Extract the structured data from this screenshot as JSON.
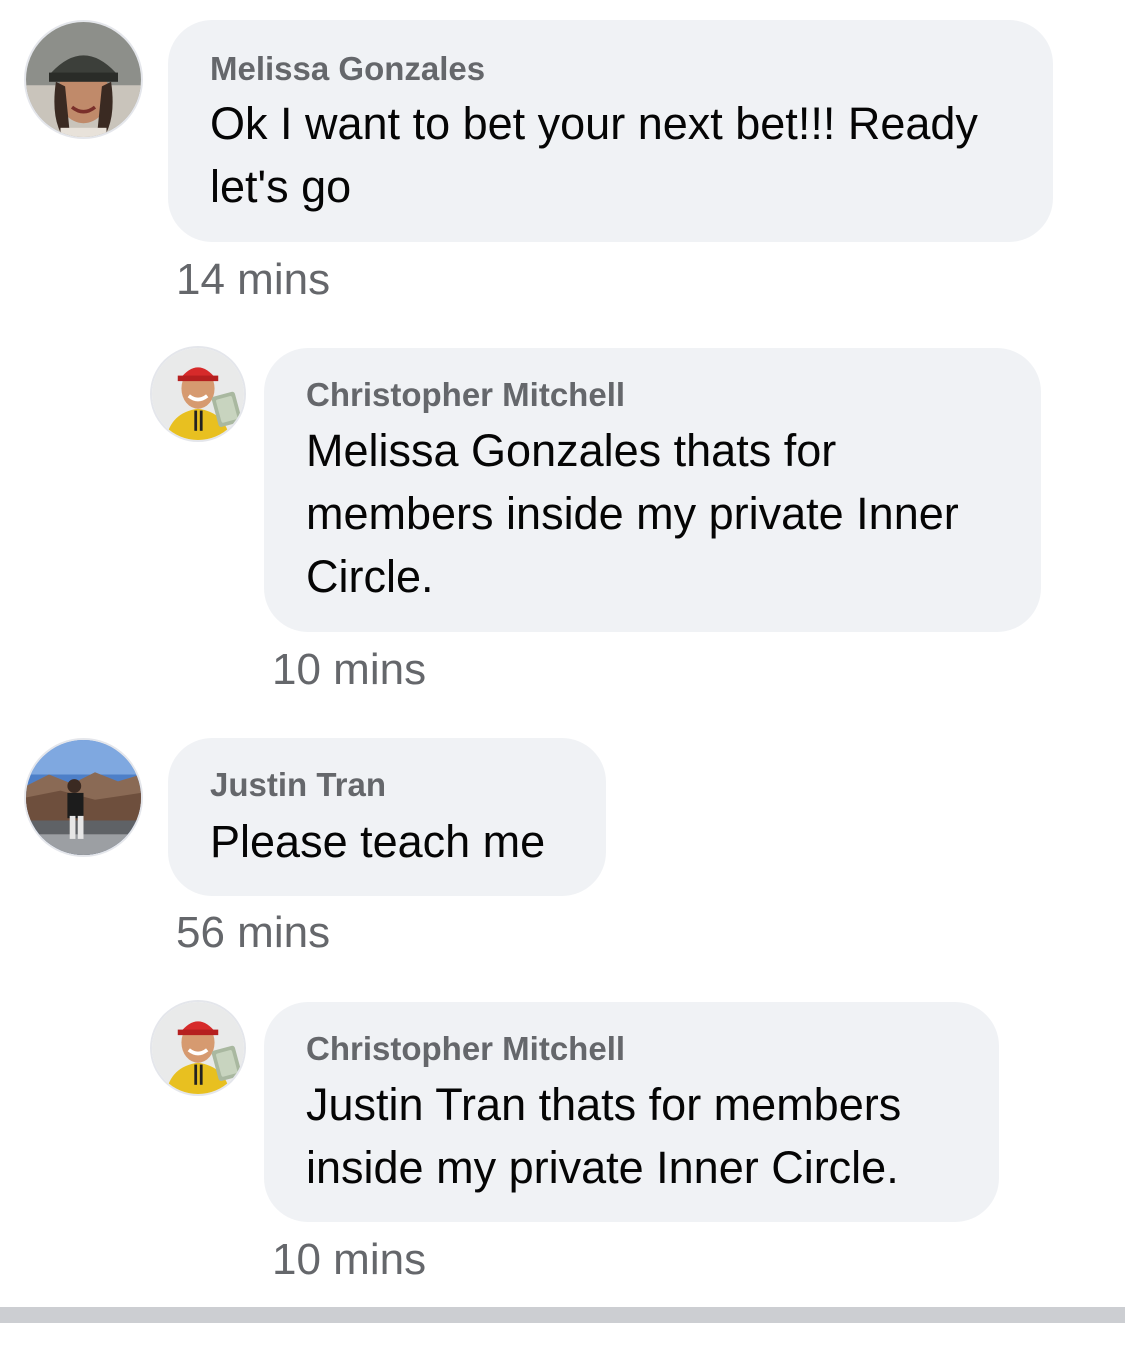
{
  "comments": [
    {
      "author": "Melissa Gonzales",
      "text_line1": "Ok I want to bet your next bet!!! Ready",
      "text_line2": "let's go",
      "time": "14 mins",
      "avatar_icon": "woman-in-cap-avatar"
    },
    {
      "author": "Christopher Mitchell",
      "text_line1": "Melissa Gonzales thats for",
      "text_line2": "members inside my private Inner",
      "text_line3": "Circle.",
      "time": "10 mins",
      "avatar_icon": "man-red-cap-cash-avatar"
    },
    {
      "author": "Justin Tran",
      "text_line1": "Please teach me",
      "time": "56 mins",
      "avatar_icon": "person-canyon-avatar"
    },
    {
      "author": "Christopher Mitchell",
      "text_line1": "Justin Tran thats for members",
      "text_line2": "inside my private Inner Circle.",
      "time": "10 mins",
      "avatar_icon": "man-red-cap-cash-avatar"
    }
  ],
  "colors": {
    "bubble": "#f0f2f5",
    "author": "#65676b",
    "text": "#050505",
    "time": "#65676b",
    "divider": "#ccced2"
  }
}
